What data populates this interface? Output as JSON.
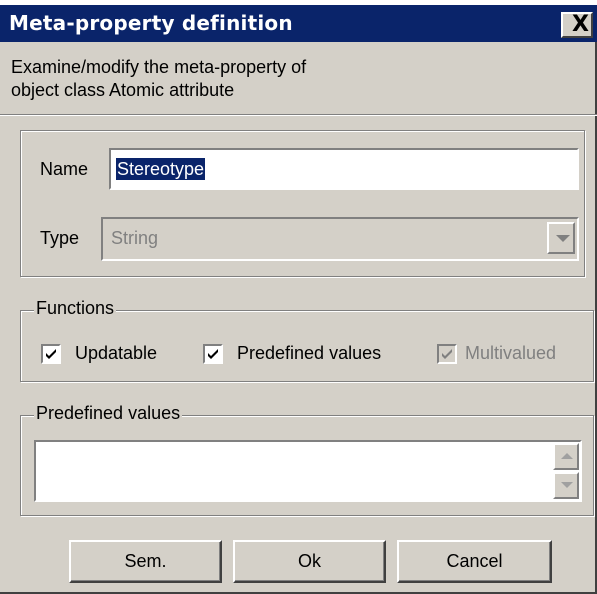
{
  "window": {
    "title": "Meta-property definition",
    "close_glyph": "X"
  },
  "description": {
    "line1": "Examine/modify the meta-property of",
    "line2": "object class Atomic attribute"
  },
  "name_field": {
    "label": "Name",
    "value": "Stereotype"
  },
  "type_field": {
    "label": "Type",
    "value": "String"
  },
  "functions": {
    "legend": "Functions",
    "options": [
      {
        "label": "Updatable",
        "checked": true,
        "enabled": true
      },
      {
        "label": "Predefined values",
        "checked": true,
        "enabled": true
      },
      {
        "label": "Multivalued",
        "checked": true,
        "enabled": false
      }
    ]
  },
  "predefined_values": {
    "legend": "Predefined values",
    "value": ""
  },
  "buttons": {
    "sem": "Sem.",
    "ok": "Ok",
    "cancel": "Cancel"
  },
  "icons": {
    "check": "check-icon",
    "dropdown": "chevron-down-icon",
    "scroll_up": "scroll-up-icon",
    "scroll_down": "scroll-down-icon"
  },
  "colors": {
    "titlebar": "#0a246a",
    "face": "#d4d0c8",
    "selection": "#0a246a",
    "disabled_text": "#808080"
  }
}
